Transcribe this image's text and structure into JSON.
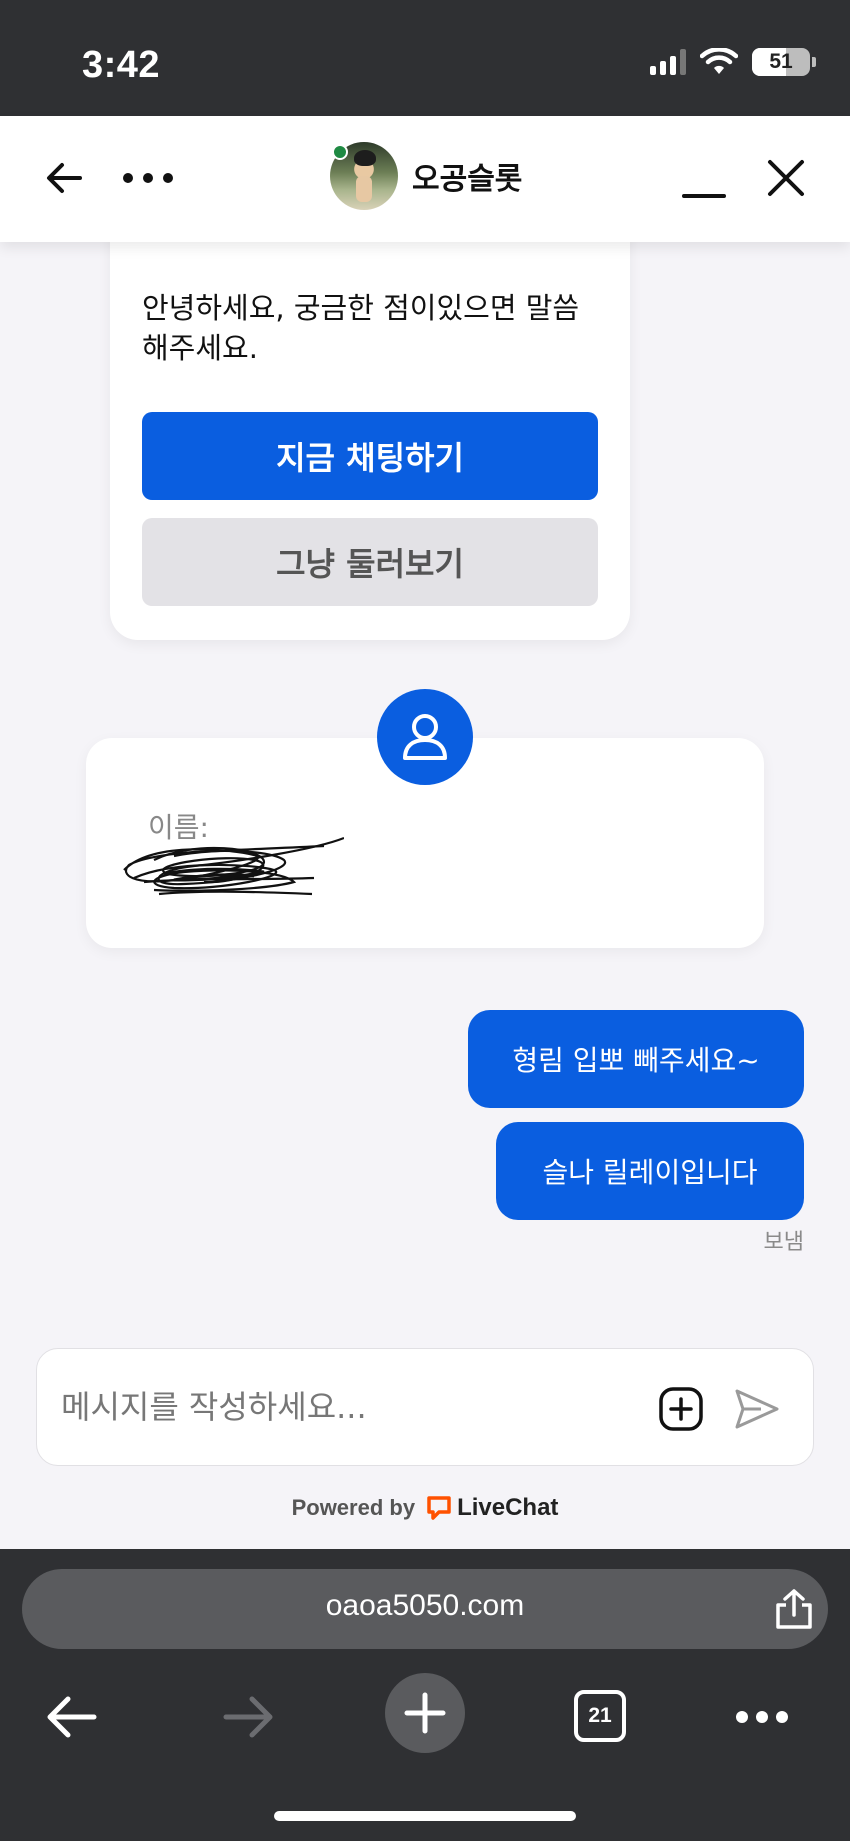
{
  "status_bar": {
    "time": "3:42",
    "battery": "51"
  },
  "header": {
    "title": "오공슬롯",
    "status_color": "#1f8a43"
  },
  "welcome_card": {
    "greeting": "안녕하세요, 궁금한 점이있으면 말씀해주세요.",
    "chat_now_label": "지금 채팅하기",
    "browse_label": "그냥 둘러보기"
  },
  "form_card": {
    "name_label": "이름:"
  },
  "messages": [
    {
      "text": "형림 입뽀 빼주세요~"
    },
    {
      "text": "슬나 릴레이입니다"
    }
  ],
  "sent_status": "보냄",
  "composer": {
    "placeholder": "메시지를 작성하세요..."
  },
  "footer": {
    "powered_by": "Powered by",
    "brand": "LiveChat",
    "brand_color": "#ff5100"
  },
  "browser": {
    "url": "oaoa5050.com",
    "tab_count": "21"
  },
  "colors": {
    "accent": "#0a5ee0",
    "secondary_button": "#e3e2e6",
    "background": "#f5f4f8"
  }
}
